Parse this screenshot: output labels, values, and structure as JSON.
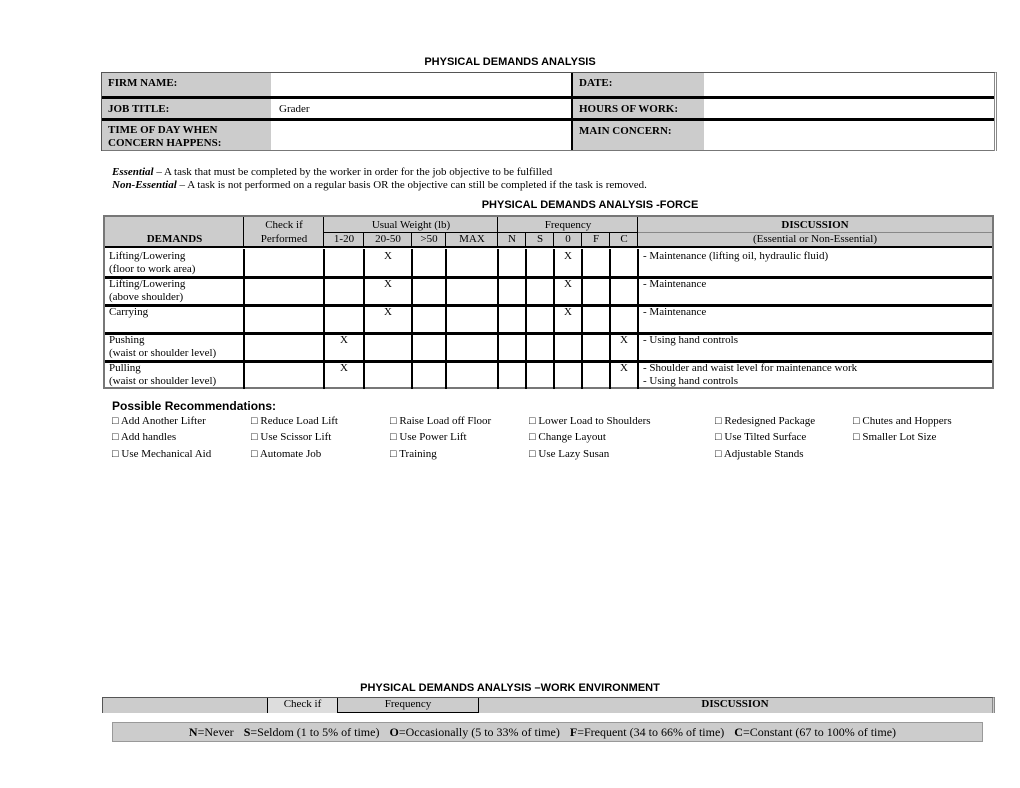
{
  "document": {
    "title": "PHYSICAL DEMANDS ANALYSIS",
    "header_fields": [
      {
        "label": "FIRM NAME:",
        "value": ""
      },
      {
        "label": "DATE:",
        "value": ""
      },
      {
        "label": "JOB TITLE:",
        "value": "Grader"
      },
      {
        "label": "HOURS OF WORK:",
        "value": ""
      },
      {
        "label": "TIME OF DAY WHEN",
        "label2": "CONCERN HAPPENS:",
        "value": ""
      },
      {
        "label": "MAIN CONCERN:",
        "value": ""
      }
    ],
    "definitions": [
      {
        "term": "Essential",
        "text": " – A task that must be completed by the worker in order for the job objective to be fulfilled"
      },
      {
        "term": "Non-Essential",
        "text": " – A task is not performed on a regular basis OR the objective can still be completed if the task is removed."
      }
    ]
  },
  "force": {
    "title": "PHYSICAL DEMANDS ANALYSIS -FORCE",
    "headers": {
      "demands": "DEMANDS",
      "check_if": "Check if",
      "performed": "Performed",
      "usual_weight": "Usual Weight (lb)",
      "weights": [
        "1-20",
        "20-50",
        ">50",
        "MAX"
      ],
      "frequency": "Frequency",
      "freqs": [
        "N",
        "S",
        "0",
        "F",
        "C"
      ],
      "discussion": "DISCUSSION",
      "discussion_sub": "(Essential or Non-Essential)"
    },
    "rows": [
      {
        "demand": "Lifting/Lowering",
        "demand2": "(floor to work area)",
        "performed": "",
        "weight": [
          "",
          "X",
          "",
          ""
        ],
        "freq": [
          "",
          "",
          "X",
          "",
          ""
        ],
        "discussion": "- Maintenance (lifting oil, hydraulic fluid)",
        "discussion2": ""
      },
      {
        "demand": "Lifting/Lowering",
        "demand2": "(above shoulder)",
        "performed": "",
        "weight": [
          "",
          "X",
          "",
          ""
        ],
        "freq": [
          "",
          "",
          "X",
          "",
          ""
        ],
        "discussion": "- Maintenance",
        "discussion2": ""
      },
      {
        "demand": "Carrying",
        "demand2": "",
        "performed": "",
        "weight": [
          "",
          "X",
          "",
          ""
        ],
        "freq": [
          "",
          "",
          "X",
          "",
          ""
        ],
        "discussion": "- Maintenance",
        "discussion2": ""
      },
      {
        "demand": "Pushing",
        "demand2": "(waist or shoulder level)",
        "performed": "",
        "weight": [
          "X",
          "",
          "",
          ""
        ],
        "freq": [
          "",
          "",
          "",
          "",
          "X"
        ],
        "discussion": "- Using hand controls",
        "discussion2": ""
      },
      {
        "demand": "Pulling",
        "demand2": "(waist or shoulder level)",
        "performed": "",
        "weight": [
          "X",
          "",
          "",
          ""
        ],
        "freq": [
          "",
          "",
          "",
          "",
          "X"
        ],
        "discussion": "- Shoulder and waist level for maintenance work",
        "discussion2": "- Using hand controls"
      }
    ]
  },
  "recommendations": {
    "title": "Possible Recommendations:",
    "checkbox_glyph": "□",
    "columns": [
      [
        "Add Another Lifter",
        "Add handles",
        "Use Mechanical Aid"
      ],
      [
        "Reduce Load Lift",
        "Use Scissor Lift",
        "Automate Job"
      ],
      [
        "Raise Load off Floor",
        "Use Power Lift",
        "Training"
      ],
      [
        "Lower Load to Shoulders",
        "Change Layout",
        "Use Lazy Susan"
      ],
      [
        "Redesigned Package",
        "Use Tilted Surface",
        "Adjustable Stands"
      ],
      [
        "Chutes and Hoppers",
        "Smaller Lot Size"
      ]
    ]
  },
  "work_environment": {
    "title": "PHYSICAL DEMANDS ANALYSIS –WORK ENVIRONMENT",
    "check_if": "Check if",
    "frequency": "Frequency",
    "discussion": "DISCUSSION"
  },
  "legend": {
    "items": [
      {
        "key": "N",
        "text": "=Never"
      },
      {
        "key": "S",
        "text": "=Seldom (1 to 5% of time)"
      },
      {
        "key": "O",
        "text": "=Occasionally (5 to 33% of time)"
      },
      {
        "key": "F",
        "text": "=Frequent (34 to 66% of time)"
      },
      {
        "key": "C",
        "text": "=Constant (67 to 100% of time)"
      }
    ]
  }
}
